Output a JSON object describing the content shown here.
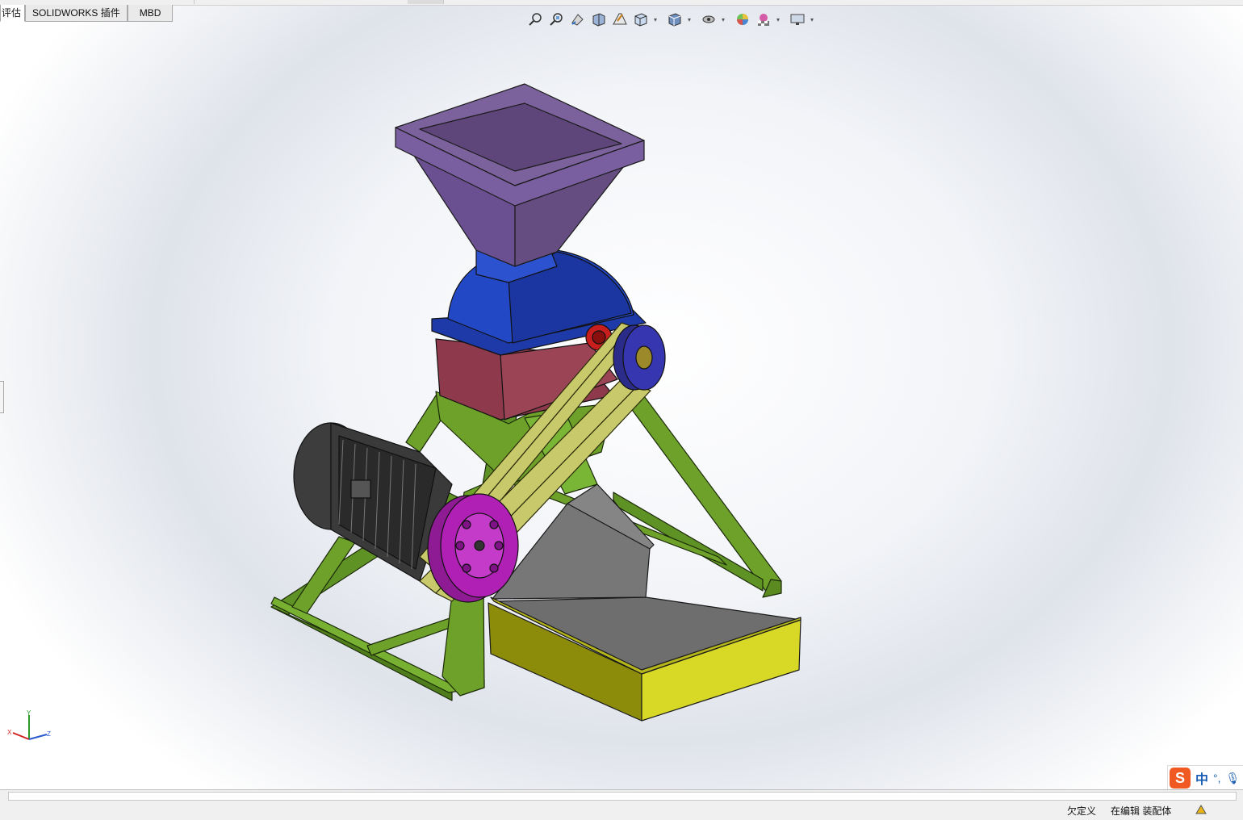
{
  "tabs": [
    {
      "label": "评估",
      "active": true
    },
    {
      "label": "SOLIDWORKS 插件",
      "active": false
    },
    {
      "label": "MBD",
      "active": false
    }
  ],
  "hud_icons": [
    "zoom-to-fit-icon",
    "zoom-to-area-icon",
    "previous-view-icon",
    "section-view-icon",
    "dynamic-annotation-icon",
    "view-orientation-icon",
    "display-style-icon",
    "hide-show-items-icon",
    "edit-appearance-icon",
    "apply-scene-icon",
    "view-settings-icon"
  ],
  "triad": {
    "x": "X",
    "y": "Y",
    "z": "Z"
  },
  "status": {
    "definition": "欠定义",
    "mode": "在编辑 装配体"
  },
  "ime": {
    "logo": "S",
    "lang": "中",
    "punct": "°,"
  },
  "colors": {
    "hopper": "#654d82",
    "housing_top": "#1d3aa8",
    "housing_bottom": "#8e3a4c",
    "frame": "#6da12a",
    "belt": "#c8c96a",
    "motor": "#3d3d3d",
    "motor_pulley": "#b020b5",
    "tray_side": "#8c8c0a",
    "tray_floor": "#6e6e6e"
  }
}
